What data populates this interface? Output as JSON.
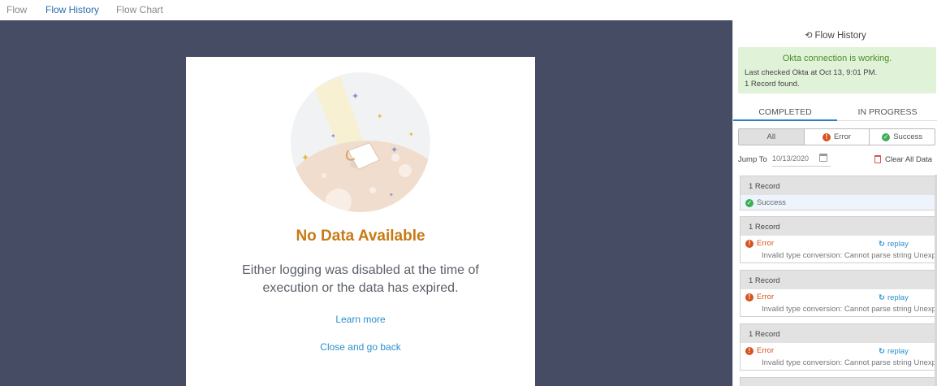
{
  "top_tabs": [
    {
      "label": "Flow"
    },
    {
      "label": "Flow History"
    },
    {
      "label": "Flow Chart"
    }
  ],
  "empty_state": {
    "title": "No Data Available",
    "message": "Either logging was disabled at the time of execution or the data has expired.",
    "learn_more": "Learn more",
    "close": "Close and go back"
  },
  "panel": {
    "title": "Flow History",
    "okta": {
      "headline": "Okta connection is working.",
      "last_checked": "Last checked Okta at Oct 13, 9:01 PM.",
      "found": "1 Record found."
    },
    "tabs": [
      "COMPLETED",
      "IN PROGRESS"
    ],
    "filters": [
      "All",
      "Error",
      "Success"
    ],
    "jump_label": "Jump To",
    "jump_placeholder": "10/13/2020",
    "clear_label": "Clear All Data",
    "records": [
      {
        "head": "1 Record",
        "status": "Success"
      },
      {
        "head": "1 Record",
        "status": "Error",
        "replay": "replay",
        "message": "Invalid type conversion: Cannot parse string Unexp"
      },
      {
        "head": "1 Record",
        "status": "Error",
        "replay": "replay",
        "message": "Invalid type conversion: Cannot parse string Unexp"
      },
      {
        "head": "1 Record",
        "status": "Error",
        "replay": "replay",
        "message": "Invalid type conversion: Cannot parse string Unexp"
      }
    ]
  },
  "colors": {
    "canvas": "#464c64",
    "title_orange": "#c77a14",
    "link_blue": "#2a8fd0",
    "error_red": "#d9531e",
    "success_green": "#3fae5a",
    "okta_bg": "#e0f2d8"
  }
}
